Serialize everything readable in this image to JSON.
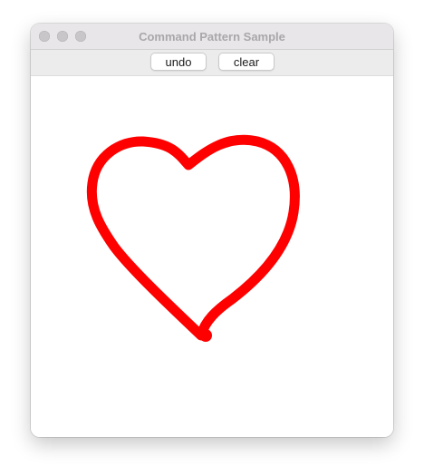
{
  "window": {
    "title": "Command Pattern Sample"
  },
  "toolbar": {
    "undo_label": "undo",
    "clear_label": "clear"
  },
  "canvas": {
    "drawing": "heart-stroke",
    "stroke_color": "#ff0000"
  },
  "colors": {
    "titlebar_bg": "#e8e6e8",
    "toolbar_bg": "#ececec",
    "title_text": "#a9a7a9",
    "traffic_light_inactive": "#c8c6c8"
  }
}
